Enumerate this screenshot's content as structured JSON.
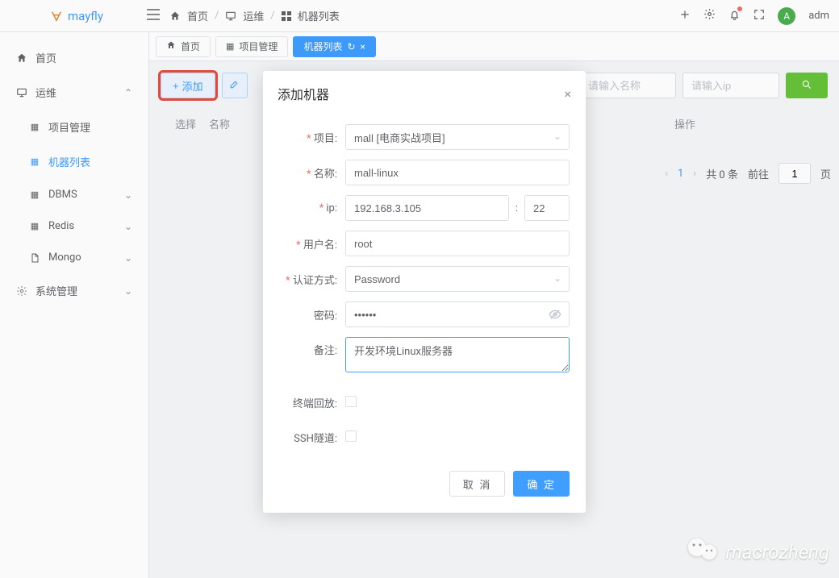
{
  "brand": {
    "name": "mayfly"
  },
  "breadcrumb": {
    "home": "首页",
    "ops": "运维",
    "list": "机器列表"
  },
  "header": {
    "user_initial": "A",
    "user_name": "adm"
  },
  "sidebar": {
    "home": "首页",
    "ops": "运维",
    "project": "项目管理",
    "machine": "机器列表",
    "dbms": "DBMS",
    "redis": "Redis",
    "mongo": "Mongo",
    "system": "系统管理"
  },
  "tabs": {
    "home": "首页",
    "project": "项目管理",
    "machine": "机器列表"
  },
  "toolbar": {
    "add": "添加",
    "name_ph": "请输入名称",
    "ip_ph": "请输入ip"
  },
  "table": {
    "th_select": "选择",
    "th_name": "名称",
    "th_op": "操作"
  },
  "pagination": {
    "current": "1",
    "total": "共 0 条",
    "goto": "前往",
    "page_input": "1",
    "page_suffix": "页"
  },
  "modal": {
    "title": "添加机器",
    "labels": {
      "project": "项目:",
      "name": "名称:",
      "ip": "ip:",
      "user": "用户名:",
      "auth": "认证方式:",
      "password": "密码:",
      "remark": "备注:",
      "replay": "终端回放:",
      "tunnel": "SSH隧道:"
    },
    "values": {
      "project": "mall [电商实战项目]",
      "name": "mall-linux",
      "ip": "192.168.3.105",
      "port": "22",
      "user": "root",
      "auth": "Password",
      "password": "••••••",
      "remark": "开发环境Linux服务器"
    },
    "buttons": {
      "cancel": "取 消",
      "confirm": "确 定"
    }
  },
  "watermark": "macrozheng"
}
